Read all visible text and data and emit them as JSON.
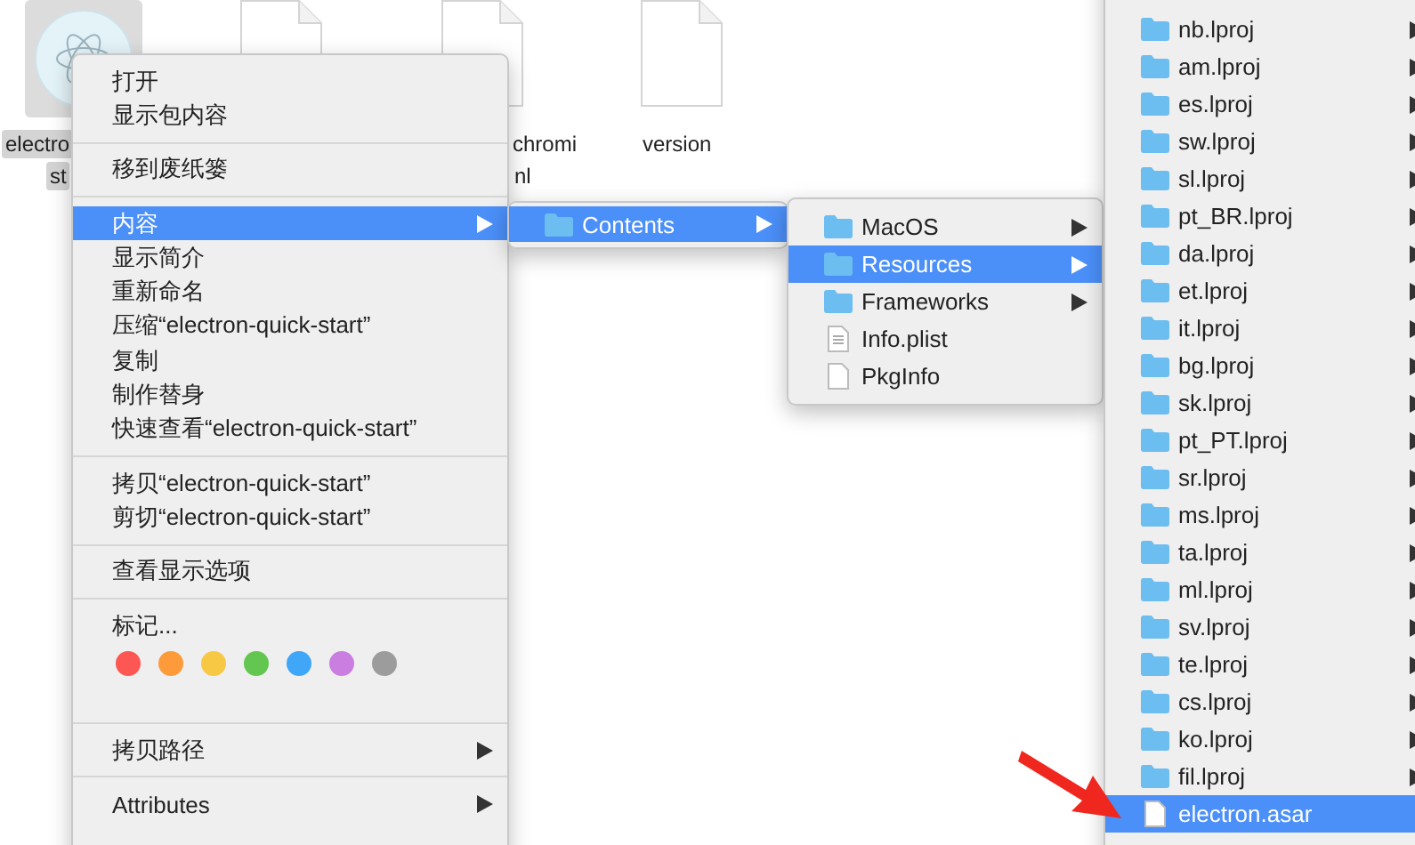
{
  "desktop": {
    "items": [
      {
        "kind": "app",
        "selected": true,
        "label_lines": [
          "electro",
          "st"
        ]
      },
      {
        "kind": "file"
      },
      {
        "kind": "file",
        "label_lines": [
          "chromi",
          "nl"
        ]
      },
      {
        "kind": "file",
        "label_lines": [
          "version"
        ]
      }
    ]
  },
  "context_menu": {
    "items": [
      {
        "kind": "item",
        "label": "打开",
        "selected": false
      },
      {
        "kind": "item",
        "label": "显示包内容",
        "selected": false
      },
      {
        "kind": "separator"
      },
      {
        "kind": "item",
        "label": "移到废纸篓",
        "selected": false
      },
      {
        "kind": "separator"
      },
      {
        "kind": "item",
        "label": "内容",
        "selected": true,
        "submenu": true
      },
      {
        "kind": "item",
        "label": "显示简介",
        "selected": false
      },
      {
        "kind": "item",
        "label": "重新命名",
        "selected": false
      },
      {
        "kind": "item",
        "label": "压缩“electron-quick-start”",
        "selected": false
      },
      {
        "kind": "item",
        "label": "复制",
        "selected": false
      },
      {
        "kind": "item",
        "label": "制作替身",
        "selected": false
      },
      {
        "kind": "item",
        "label": "快速查看“electron-quick-start”",
        "selected": false
      },
      {
        "kind": "separator"
      },
      {
        "kind": "item",
        "label": "拷贝“electron-quick-start”",
        "selected": false
      },
      {
        "kind": "item",
        "label": "剪切“electron-quick-start”",
        "selected": false
      },
      {
        "kind": "separator"
      },
      {
        "kind": "item",
        "label": "查看显示选项",
        "selected": false
      },
      {
        "kind": "separator"
      },
      {
        "kind": "item",
        "label": "标记...",
        "selected": false
      },
      {
        "kind": "tags",
        "tags": [
          {
            "color": "#fc5753"
          },
          {
            "color": "#fd9a3a"
          },
          {
            "color": "#f7c844"
          },
          {
            "color": "#63c650"
          },
          {
            "color": "#3fa6f8"
          },
          {
            "color": "#c97ee0"
          },
          {
            "color": "#9c9c9c"
          }
        ]
      },
      {
        "kind": "separator"
      },
      {
        "kind": "item",
        "label": "拷贝路径",
        "selected": false,
        "submenu": true
      },
      {
        "kind": "separator"
      },
      {
        "kind": "item",
        "label": "Attributes",
        "selected": false,
        "submenu": true
      }
    ]
  },
  "contents_menu": {
    "items": [
      {
        "kind": "folder",
        "label": "Contents",
        "selected": true,
        "submenu": true
      }
    ]
  },
  "bundle_menu": {
    "items": [
      {
        "kind": "folder",
        "label": "MacOS",
        "selected": false,
        "submenu": true
      },
      {
        "kind": "folder",
        "label": "Resources",
        "selected": true,
        "submenu": true
      },
      {
        "kind": "folder",
        "label": "Frameworks",
        "selected": false,
        "submenu": true
      },
      {
        "kind": "plist",
        "label": "Info.plist",
        "selected": false,
        "submenu": false
      },
      {
        "kind": "file",
        "label": "PkgInfo",
        "selected": false,
        "submenu": false
      }
    ]
  },
  "resources_menu": {
    "items": [
      {
        "kind": "folder",
        "label": "nb.lproj",
        "selected": false,
        "submenu": true
      },
      {
        "kind": "folder",
        "label": "am.lproj",
        "selected": false,
        "submenu": true
      },
      {
        "kind": "folder",
        "label": "es.lproj",
        "selected": false,
        "submenu": true
      },
      {
        "kind": "folder",
        "label": "sw.lproj",
        "selected": false,
        "submenu": true
      },
      {
        "kind": "folder",
        "label": "sl.lproj",
        "selected": false,
        "submenu": true
      },
      {
        "kind": "folder",
        "label": "pt_BR.lproj",
        "selected": false,
        "submenu": true
      },
      {
        "kind": "folder",
        "label": "da.lproj",
        "selected": false,
        "submenu": true
      },
      {
        "kind": "folder",
        "label": "et.lproj",
        "selected": false,
        "submenu": true
      },
      {
        "kind": "folder",
        "label": "it.lproj",
        "selected": false,
        "submenu": true
      },
      {
        "kind": "folder",
        "label": "bg.lproj",
        "selected": false,
        "submenu": true
      },
      {
        "kind": "folder",
        "label": "sk.lproj",
        "selected": false,
        "submenu": true
      },
      {
        "kind": "folder",
        "label": "pt_PT.lproj",
        "selected": false,
        "submenu": true
      },
      {
        "kind": "folder",
        "label": "sr.lproj",
        "selected": false,
        "submenu": true
      },
      {
        "kind": "folder",
        "label": "ms.lproj",
        "selected": false,
        "submenu": true
      },
      {
        "kind": "folder",
        "label": "ta.lproj",
        "selected": false,
        "submenu": true
      },
      {
        "kind": "folder",
        "label": "ml.lproj",
        "selected": false,
        "submenu": true
      },
      {
        "kind": "folder",
        "label": "sv.lproj",
        "selected": false,
        "submenu": true
      },
      {
        "kind": "folder",
        "label": "te.lproj",
        "selected": false,
        "submenu": true
      },
      {
        "kind": "folder",
        "label": "cs.lproj",
        "selected": false,
        "submenu": true
      },
      {
        "kind": "folder",
        "label": "ko.lproj",
        "selected": false,
        "submenu": true
      },
      {
        "kind": "folder",
        "label": "fil.lproj",
        "selected": false,
        "submenu": true
      },
      {
        "kind": "file",
        "label": "electron.asar",
        "selected": true,
        "submenu": false
      }
    ]
  }
}
